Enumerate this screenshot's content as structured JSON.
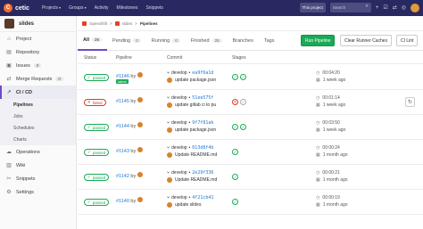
{
  "topbar": {
    "brand": "cetic",
    "logo_char": "C",
    "nav": [
      "Projects",
      "Groups",
      "Activity",
      "Milestones",
      "Snippets"
    ],
    "project_button": "This project",
    "search_placeholder": "Search"
  },
  "sidebar": {
    "project_name": "slides",
    "items": [
      {
        "label": "Project",
        "icon": "home-icon"
      },
      {
        "label": "Repository",
        "icon": "doc-icon"
      },
      {
        "label": "Issues",
        "icon": "issues-icon",
        "count": "0"
      },
      {
        "label": "Merge Requests",
        "icon": "merge-icon",
        "count": "0"
      },
      {
        "label": "CI / CD",
        "icon": "rocket-icon"
      },
      {
        "label": "Operations",
        "icon": "cloud-icon"
      },
      {
        "label": "Wiki",
        "icon": "book-icon"
      },
      {
        "label": "Snippets",
        "icon": "scissors-icon"
      },
      {
        "label": "Settings",
        "icon": "gear-icon"
      }
    ],
    "sub_items": [
      "Pipelines",
      "Jobs",
      "Schedules",
      "Charts"
    ]
  },
  "breadcrumb": [
    "OpenShift",
    "slides",
    "Pipelines"
  ],
  "tabs": [
    {
      "label": "All",
      "count": "25"
    },
    {
      "label": "Pending",
      "count": "0"
    },
    {
      "label": "Running",
      "count": "0"
    },
    {
      "label": "Finished",
      "count": "25"
    },
    {
      "label": "Branches"
    },
    {
      "label": "Tags"
    }
  ],
  "buttons": {
    "run": "Run Pipeline",
    "clear": "Clear Runner Caches",
    "lint": "CI Lint"
  },
  "columns": [
    "Status",
    "Pipeline",
    "Commit",
    "Stages"
  ],
  "latest_label": "latest",
  "pipelines": [
    {
      "status": "passed",
      "id": "#1146",
      "by": "by",
      "latest": true,
      "branch": "develop",
      "sha": "ea9f6a1d",
      "message": "update package.json",
      "stages": [
        "ok",
        "ok"
      ],
      "duration": "00:04:20",
      "ago": "1 week ago"
    },
    {
      "status": "failed",
      "id": "#1145",
      "by": "by",
      "latest": false,
      "branch": "develop",
      "sha": "51ee575f",
      "message": "update gitlab ci to pu",
      "stages": [
        "fail",
        "skip"
      ],
      "duration": "00:01:14",
      "ago": "1 week ago"
    },
    {
      "status": "passed",
      "id": "#1144",
      "by": "by",
      "latest": false,
      "branch": "develop",
      "sha": "9f7f81ab",
      "message": "update package.json",
      "stages": [
        "ok",
        "ok"
      ],
      "duration": "00:03:50",
      "ago": "1 week ago"
    },
    {
      "status": "passed",
      "id": "#1143",
      "by": "by",
      "latest": false,
      "branch": "develop",
      "sha": "013d8f4b",
      "message": "Update README.md",
      "stages": [
        "ok"
      ],
      "duration": "00:00:24",
      "ago": "1 month ago"
    },
    {
      "status": "passed",
      "id": "#1142",
      "by": "by",
      "latest": false,
      "branch": "develop",
      "sha": "2e29f336",
      "message": "Update README.md",
      "stages": [
        "ok"
      ],
      "duration": "00:00:21",
      "ago": "1 month ago"
    },
    {
      "status": "passed",
      "id": "#1140",
      "by": "by",
      "latest": false,
      "branch": "develop",
      "sha": "4f21cb41",
      "message": "update slides",
      "stages": [
        "ok"
      ],
      "duration": "00:00:19",
      "ago": "1 month ago"
    }
  ]
}
